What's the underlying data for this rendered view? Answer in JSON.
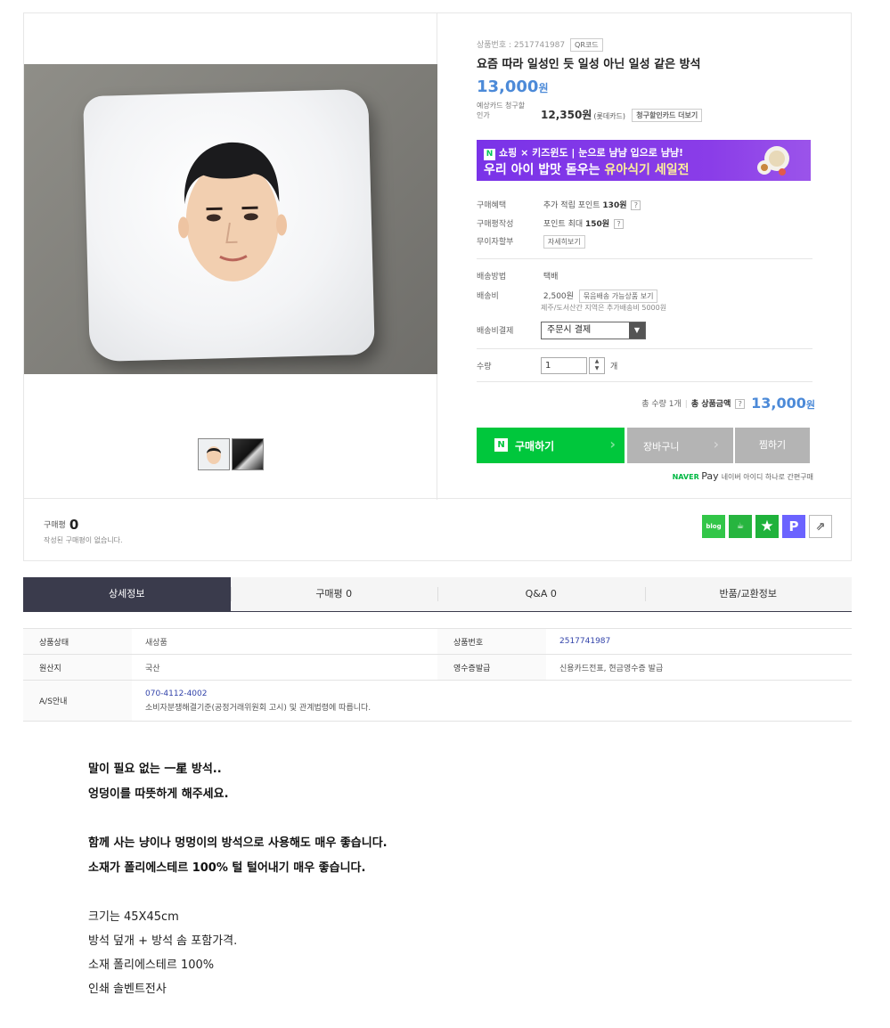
{
  "product": {
    "number_label": "상품번호 : 2517741987",
    "qr_label": "QR코드",
    "title": "요즘 따라 일성인 듯 일성 아닌 일성 같은 방석",
    "price": "13,000",
    "price_unit": "원",
    "card_label": "예상카드 청구할인가",
    "card_price": "12,350원",
    "card_name": "(롯데카드)",
    "card_more": "청구할인카드 더보기"
  },
  "banner": {
    "n_logo": "N",
    "line1": "쇼핑 × 키즈윈도 | 눈으로 냠냠 입으로 냠냠!",
    "line2_prefix": "우리 아이 밥맛 돋우는 ",
    "line2_highlight": "유아식기 세일전"
  },
  "benefits": {
    "purchase_label": "구매혜택",
    "purchase_pre": "추가 적립 포인트 ",
    "purchase_value": "130원",
    "review_label": "구매평작성",
    "review_pre": "포인트 최대 ",
    "review_value": "150원",
    "installment_label": "무이자할부",
    "installment_btn": "자세히보기"
  },
  "shipping": {
    "method_label": "배송방법",
    "method_value": "택배",
    "fee_label": "배송비",
    "fee_value": "2,500원",
    "fee_btn": "묶음배송 가능상품 보기",
    "fee_note": "제주/도서산간 지역은 추가배송비 5000원",
    "pay_label": "배송비결제",
    "pay_option": "주문시 결제"
  },
  "quantity": {
    "label": "수량",
    "value": "1",
    "unit": "개"
  },
  "total": {
    "qty_text": "총 수량 1개",
    "amount_label": "총 상품금액",
    "amount": "13,000",
    "amount_unit": "원"
  },
  "buttons": {
    "buy": "구매하기",
    "cart": "장바구니",
    "wish": "찜하기",
    "n_logo": "N"
  },
  "naverpay": {
    "logo": "NAVER",
    "pay": "Pay",
    "text": "네이버 아이디 하나로 간편구매"
  },
  "review": {
    "label": "구매평",
    "count": "0",
    "empty": "작성된 구매평이 없습니다."
  },
  "share": {
    "blog": "blog",
    "cafe": "☕",
    "star": "★",
    "p": "P",
    "share": "⇗"
  },
  "tabs": [
    {
      "label": "상세정보"
    },
    {
      "label": "구매평 0"
    },
    {
      "label": "Q&A 0"
    },
    {
      "label": "반품/교환정보"
    }
  ],
  "info": {
    "condition_label": "상품상태",
    "condition_value": "새상품",
    "prodno_label": "상품번호",
    "prodno_value": "2517741987",
    "origin_label": "원산지",
    "origin_value": "국산",
    "receipt_label": "영수증발급",
    "receipt_value": "신용카드전표, 현금영수증 발급",
    "as_label": "A/S안내",
    "as_phone": "070-4112-4002",
    "as_note": "소비자분쟁해결기준(공정거래위원회 고시) 및 관계법령에 따릅니다."
  },
  "description": {
    "bold_lines": [
      "말이 필요 없는 一星 방석..",
      "엉덩이를 따뜻하게 해주세요.",
      "함께 사는 냥이나 멍멍이의 방석으로 사용해도 매우 좋습니다.",
      "소재가 폴리에스테르 100% 털 털어내기 매우 좋습니다."
    ],
    "normal_lines": [
      "크기는 45X45cm",
      "방석 덮개 + 방석 솜 포함가격.",
      "소재 폴리에스테르 100%",
      "인쇄 솔벤트전사"
    ]
  },
  "colors": {
    "price_blue": "#4c8ad8",
    "buy_green": "#00c73c",
    "banner_purple": "#7a33e8",
    "tab_active": "#3a3b4c"
  }
}
